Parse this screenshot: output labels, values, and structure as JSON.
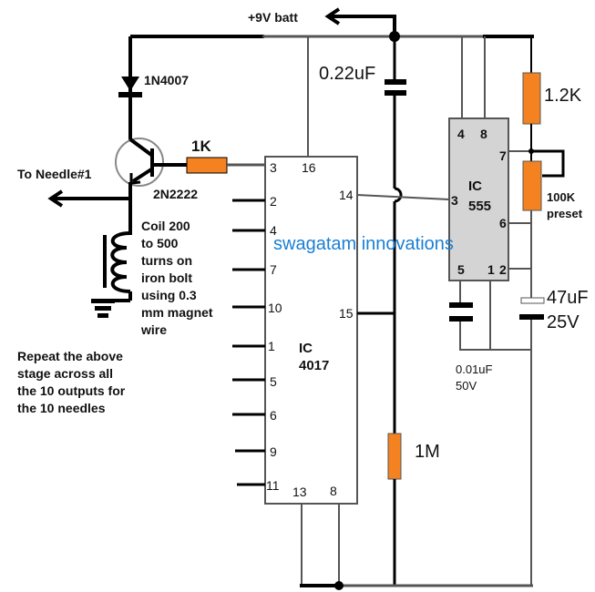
{
  "supply": {
    "label": "+9V batt"
  },
  "diode": {
    "label": "1N4007"
  },
  "transistor": {
    "label": "2N2222"
  },
  "base_resistor": {
    "label": "1K"
  },
  "needle_output": {
    "label": "To Needle#1"
  },
  "coil": {
    "lines": [
      "Coil 200",
      "to 500",
      "turns on",
      "iron bolt",
      "using 0.3",
      "mm magnet",
      "wire"
    ]
  },
  "note": {
    "lines": [
      "Repeat the above",
      "stage across all",
      "the 10 outputs for",
      "the 10 needles"
    ]
  },
  "ic4017": {
    "name": [
      "IC",
      "4017"
    ],
    "left_pins": [
      "3",
      "2",
      "4",
      "7",
      "10",
      "1",
      "5",
      "6",
      "9",
      "11"
    ],
    "pin16": "16",
    "pin14": "14",
    "pin15": "15",
    "pin13": "13",
    "pin8": "8"
  },
  "ic555": {
    "name": [
      "IC",
      "555"
    ],
    "pins": {
      "p4": "4",
      "p8": "8",
      "p7": "7",
      "p3": "3",
      "p6": "6",
      "p5": "5",
      "p1": "1",
      "p2": "2"
    }
  },
  "coupling_cap": {
    "label": "0.22uF"
  },
  "r1": {
    "label": "1.2K"
  },
  "preset": {
    "lines": [
      "100K",
      "preset"
    ]
  },
  "timing_cap": {
    "lines": [
      "47uF",
      "25V"
    ]
  },
  "ctrl_cap": {
    "lines": [
      "0.01uF",
      "50V"
    ]
  },
  "reset_resistor": {
    "label": "1M"
  },
  "watermark": "swagatam innovations",
  "colors": {
    "resistor": "#f58220",
    "ic_fill": "#d4d4d4",
    "watermark": "#1a7fd4"
  }
}
